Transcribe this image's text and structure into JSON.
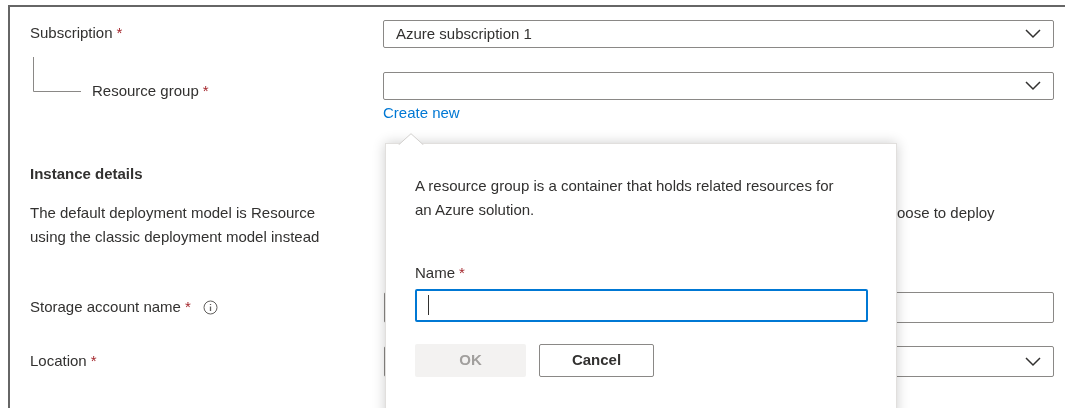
{
  "project_fields": [
    {
      "label": "Subscription",
      "required": "*",
      "kind": "dropdown",
      "value": "Azure subscription 1",
      "indent": false
    },
    {
      "label": "Resource group",
      "required": "*",
      "kind": "dropdown",
      "indent": true,
      "link": "Create new"
    }
  ],
  "instance": {
    "heading": "Instance details",
    "description_lines": [
      {
        "left": "The default deployment model is Resource",
        "right": "oose to deploy"
      },
      {
        "left": "using the classic deployment model instead"
      }
    ]
  },
  "instance_fields": [
    {
      "label": "Storage account name",
      "required": "*",
      "kind": "text",
      "info": true
    },
    {
      "label": "Location",
      "required": "*",
      "kind": "dropdown",
      "info": false
    }
  ],
  "popup": {
    "text": "A resource group is a container that holds related resources for an Azure solution.",
    "field_label": "Name",
    "required": "*",
    "buttons": [
      {
        "label": "OK",
        "disabled": true
      },
      {
        "label": "Cancel",
        "disabled": false
      }
    ]
  }
}
